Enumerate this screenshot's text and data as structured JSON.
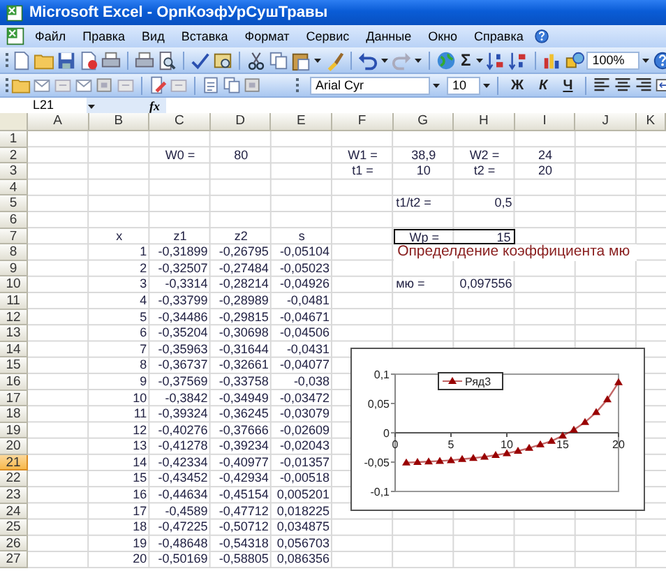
{
  "window": {
    "title": "Microsoft Excel - ОрпКоэфУрСушТравы"
  },
  "menu": [
    "Файл",
    "Правка",
    "Вид",
    "Вставка",
    "Формат",
    "Сервис",
    "Данные",
    "Окно",
    "Справка"
  ],
  "toolbar": {
    "sum": "Σ",
    "zoom": "100%"
  },
  "format_bar": {
    "font": "Arial Cyr",
    "size": "10",
    "bold": "Ж",
    "italic": "К",
    "underline": "Ч"
  },
  "formula_bar": {
    "name_box": "L21",
    "fx": "fx"
  },
  "sheet": {
    "columns": [
      {
        "label": "A",
        "selected": false
      },
      {
        "label": "B",
        "selected": false
      },
      {
        "label": "C",
        "selected": false
      },
      {
        "label": "D",
        "selected": false
      },
      {
        "label": "E",
        "selected": false
      },
      {
        "label": "F",
        "selected": false
      },
      {
        "label": "G",
        "selected": false
      },
      {
        "label": "H",
        "selected": false
      },
      {
        "label": "I",
        "selected": false
      },
      {
        "label": "J",
        "selected": false
      },
      {
        "label": "K",
        "selected": false
      }
    ],
    "rows": [
      {
        "number": "1",
        "selected": false,
        "cells": {}
      },
      {
        "number": "2",
        "selected": false,
        "cells": {
          "C": {
            "text": "W0  =",
            "kind": "label"
          },
          "D": {
            "text": "80",
            "kind": "label"
          },
          "F": {
            "text": "W1  =",
            "kind": "label"
          },
          "G": {
            "text": "38,9",
            "kind": "label"
          },
          "H": {
            "text": "W2  =",
            "kind": "label"
          },
          "I": {
            "text": "24",
            "kind": "label"
          }
        }
      },
      {
        "number": "3",
        "selected": false,
        "cells": {
          "F": {
            "text": "t1  =",
            "kind": "label"
          },
          "G": {
            "text": "10",
            "kind": "label"
          },
          "H": {
            "text": "t2    =",
            "kind": "label"
          },
          "I": {
            "text": "20",
            "kind": "label"
          }
        }
      },
      {
        "number": "4",
        "selected": false,
        "cells": {}
      },
      {
        "number": "5",
        "selected": false,
        "cells": {
          "G": {
            "text": "t1/t2  =",
            "kind": "left"
          },
          "H": {
            "text": "0,5",
            "kind": "number"
          }
        }
      },
      {
        "number": "6",
        "selected": false,
        "cells": {}
      },
      {
        "number": "7",
        "selected": false,
        "cells": {
          "B": {
            "text": "x",
            "kind": "label"
          },
          "C": {
            "text": "z1",
            "kind": "label"
          },
          "D": {
            "text": "z2",
            "kind": "label"
          },
          "E": {
            "text": "s",
            "kind": "label"
          },
          "G": {
            "text": "Wp  =",
            "kind": "label",
            "boxed": true
          },
          "H": {
            "text": "15",
            "kind": "number",
            "boxed": true
          }
        }
      },
      {
        "number": "8",
        "selected": false,
        "cells": {
          "B": {
            "text": "1",
            "kind": "number"
          },
          "C": {
            "text": "-0,31899",
            "kind": "number"
          },
          "D": {
            "text": "-0,26795",
            "kind": "number"
          },
          "E": {
            "text": "-0,05104",
            "kind": "number"
          },
          "G": {
            "text": "Определдение  коэффициента мю",
            "kind": "heading"
          }
        }
      },
      {
        "number": "9",
        "selected": false,
        "cells": {
          "B": {
            "text": "2",
            "kind": "number"
          },
          "C": {
            "text": "-0,32507",
            "kind": "number"
          },
          "D": {
            "text": "-0,27484",
            "kind": "number"
          },
          "E": {
            "text": "-0,05023",
            "kind": "number"
          }
        }
      },
      {
        "number": "10",
        "selected": false,
        "cells": {
          "B": {
            "text": "3",
            "kind": "number"
          },
          "C": {
            "text": "-0,3314",
            "kind": "number"
          },
          "D": {
            "text": "-0,28214",
            "kind": "number"
          },
          "E": {
            "text": "-0,04926",
            "kind": "number"
          },
          "G": {
            "text": "мю =",
            "kind": "left"
          },
          "H": {
            "text": "0,097556",
            "kind": "number"
          }
        }
      },
      {
        "number": "11",
        "selected": false,
        "cells": {
          "B": {
            "text": "4",
            "kind": "number"
          },
          "C": {
            "text": "-0,33799",
            "kind": "number"
          },
          "D": {
            "text": "-0,28989",
            "kind": "number"
          },
          "E": {
            "text": "-0,0481",
            "kind": "number"
          }
        }
      },
      {
        "number": "12",
        "selected": false,
        "cells": {
          "B": {
            "text": "5",
            "kind": "number"
          },
          "C": {
            "text": "-0,34486",
            "kind": "number"
          },
          "D": {
            "text": "-0,29815",
            "kind": "number"
          },
          "E": {
            "text": "-0,04671",
            "kind": "number"
          }
        }
      },
      {
        "number": "13",
        "selected": false,
        "cells": {
          "B": {
            "text": "6",
            "kind": "number"
          },
          "C": {
            "text": "-0,35204",
            "kind": "number"
          },
          "D": {
            "text": "-0,30698",
            "kind": "number"
          },
          "E": {
            "text": "-0,04506",
            "kind": "number"
          }
        }
      },
      {
        "number": "14",
        "selected": false,
        "cells": {
          "B": {
            "text": "7",
            "kind": "number"
          },
          "C": {
            "text": "-0,35963",
            "kind": "number"
          },
          "D": {
            "text": "-0,31644",
            "kind": "number"
          },
          "E": {
            "text": "-0,0431",
            "kind": "number"
          }
        }
      },
      {
        "number": "15",
        "selected": false,
        "cells": {
          "B": {
            "text": "8",
            "kind": "number"
          },
          "C": {
            "text": "-0,36737",
            "kind": "number"
          },
          "D": {
            "text": "-0,32661",
            "kind": "number"
          },
          "E": {
            "text": "-0,04077",
            "kind": "number"
          }
        }
      },
      {
        "number": "16",
        "selected": false,
        "cells": {
          "B": {
            "text": "9",
            "kind": "number"
          },
          "C": {
            "text": "-0,37569",
            "kind": "number"
          },
          "D": {
            "text": "-0,33758",
            "kind": "number"
          },
          "E": {
            "text": "-0,038",
            "kind": "number"
          }
        }
      },
      {
        "number": "17",
        "selected": false,
        "cells": {
          "B": {
            "text": "10",
            "kind": "number"
          },
          "C": {
            "text": "-0,3842",
            "kind": "number"
          },
          "D": {
            "text": "-0,34949",
            "kind": "number"
          },
          "E": {
            "text": "-0,03472",
            "kind": "number"
          }
        }
      },
      {
        "number": "18",
        "selected": false,
        "cells": {
          "B": {
            "text": "11",
            "kind": "number"
          },
          "C": {
            "text": "-0,39324",
            "kind": "number"
          },
          "D": {
            "text": "-0,36245",
            "kind": "number"
          },
          "E": {
            "text": "-0,03079",
            "kind": "number"
          }
        }
      },
      {
        "number": "19",
        "selected": false,
        "cells": {
          "B": {
            "text": "12",
            "kind": "number"
          },
          "C": {
            "text": "-0,40276",
            "kind": "number"
          },
          "D": {
            "text": "-0,37666",
            "kind": "number"
          },
          "E": {
            "text": "-0,02609",
            "kind": "number"
          }
        }
      },
      {
        "number": "20",
        "selected": false,
        "cells": {
          "B": {
            "text": "13",
            "kind": "number"
          },
          "C": {
            "text": "-0,41278",
            "kind": "number"
          },
          "D": {
            "text": "-0,39234",
            "kind": "number"
          },
          "E": {
            "text": "-0,02043",
            "kind": "number"
          }
        }
      },
      {
        "number": "21",
        "selected": true,
        "cells": {
          "B": {
            "text": "14",
            "kind": "number"
          },
          "C": {
            "text": "-0,42334",
            "kind": "number"
          },
          "D": {
            "text": "-0,40977",
            "kind": "number"
          },
          "E": {
            "text": "-0,01357",
            "kind": "number"
          }
        }
      },
      {
        "number": "22",
        "selected": false,
        "cells": {
          "B": {
            "text": "15",
            "kind": "number"
          },
          "C": {
            "text": "-0,43452",
            "kind": "number"
          },
          "D": {
            "text": "-0,42934",
            "kind": "number"
          },
          "E": {
            "text": "-0,00518",
            "kind": "number"
          }
        }
      },
      {
        "number": "23",
        "selected": false,
        "cells": {
          "B": {
            "text": "16",
            "kind": "number"
          },
          "C": {
            "text": "-0,44634",
            "kind": "number"
          },
          "D": {
            "text": "-0,45154",
            "kind": "number"
          },
          "E": {
            "text": "0,005201",
            "kind": "number"
          }
        }
      },
      {
        "number": "24",
        "selected": false,
        "cells": {
          "B": {
            "text": "17",
            "kind": "number"
          },
          "C": {
            "text": "-0,4589",
            "kind": "number"
          },
          "D": {
            "text": "-0,47712",
            "kind": "number"
          },
          "E": {
            "text": "0,018225",
            "kind": "number"
          }
        }
      },
      {
        "number": "25",
        "selected": false,
        "cells": {
          "B": {
            "text": "18",
            "kind": "number"
          },
          "C": {
            "text": "-0,47225",
            "kind": "number"
          },
          "D": {
            "text": "-0,50712",
            "kind": "number"
          },
          "E": {
            "text": "0,034875",
            "kind": "number"
          }
        }
      },
      {
        "number": "26",
        "selected": false,
        "cells": {
          "B": {
            "text": "19",
            "kind": "number"
          },
          "C": {
            "text": "-0,48648",
            "kind": "number"
          },
          "D": {
            "text": "-0,54318",
            "kind": "number"
          },
          "E": {
            "text": "0,056703",
            "kind": "number"
          }
        }
      },
      {
        "number": "27",
        "selected": false,
        "cells": {
          "B": {
            "text": "20",
            "kind": "number"
          },
          "C": {
            "text": "-0,50169",
            "kind": "number"
          },
          "D": {
            "text": "-0,58805",
            "kind": "number"
          },
          "E": {
            "text": "0,086356",
            "kind": "number"
          }
        }
      }
    ]
  },
  "chart": {
    "chart_data": {
      "type": "line",
      "x": [
        1,
        2,
        3,
        4,
        5,
        6,
        7,
        8,
        9,
        10,
        11,
        12,
        13,
        14,
        15,
        16,
        17,
        18,
        19,
        20
      ],
      "series": [
        {
          "name": "Ряд3",
          "color": "#990000",
          "marker": "triangle",
          "values": [
            -0.051,
            -0.05,
            -0.049,
            -0.048,
            -0.047,
            -0.045,
            -0.043,
            -0.041,
            -0.038,
            -0.035,
            -0.031,
            -0.026,
            -0.02,
            -0.014,
            -0.005,
            0.005,
            0.018,
            0.035,
            0.057,
            0.086
          ]
        }
      ],
      "xlim": [
        0,
        20
      ],
      "ylim": [
        -0.1,
        0.1
      ],
      "xticks": [
        {
          "value": 0,
          "label": "0"
        },
        {
          "value": 5,
          "label": "5"
        },
        {
          "value": 10,
          "label": "10"
        },
        {
          "value": 15,
          "label": "15"
        },
        {
          "value": 20,
          "label": "20"
        }
      ],
      "yticks": [
        {
          "value": 0.1,
          "label": "0,1"
        },
        {
          "value": 0.05,
          "label": "0,05"
        },
        {
          "value": 0,
          "label": "0"
        },
        {
          "value": -0.05,
          "label": "-0,05"
        },
        {
          "value": -0.1,
          "label": "-0,1"
        }
      ]
    }
  }
}
